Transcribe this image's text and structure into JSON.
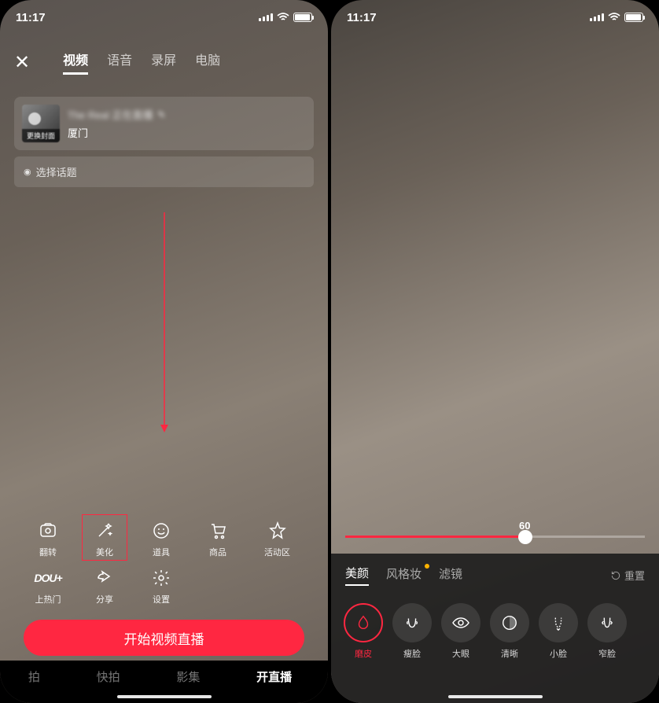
{
  "status": {
    "time": "11:17"
  },
  "left": {
    "tabs": [
      "视频",
      "语音",
      "录屏",
      "电脑"
    ],
    "active_tab": 0,
    "cover_label": "更换封面",
    "title_blur": "The Real 正在直播",
    "location": "厦门",
    "topic_label": "选择话题",
    "tools_row1": [
      {
        "label": "翻转",
        "icon": "flip"
      },
      {
        "label": "美化",
        "icon": "wand",
        "highlight": true
      },
      {
        "label": "道具",
        "icon": "smile"
      },
      {
        "label": "商品",
        "icon": "cart"
      },
      {
        "label": "活动区",
        "icon": "star"
      }
    ],
    "tools_row2": [
      {
        "label": "上热门",
        "icon": "dou",
        "text": "DOU+"
      },
      {
        "label": "分享",
        "icon": "share"
      },
      {
        "label": "设置",
        "icon": "settings"
      }
    ],
    "start_button": "开始视频直播",
    "bottom_tabs": [
      "拍",
      "快拍",
      "影集",
      "开直播"
    ],
    "bottom_active": 3
  },
  "right": {
    "slider_value": "60",
    "slider_percent": 60,
    "beauty_tabs": [
      {
        "label": "美颜",
        "active": true
      },
      {
        "label": "风格妆",
        "badge": true
      },
      {
        "label": "滤镜"
      }
    ],
    "reset_label": "重置",
    "beauty_opts": [
      {
        "label": "磨皮",
        "icon": "drop",
        "active": true
      },
      {
        "label": "瘦脸",
        "icon": "face"
      },
      {
        "label": "大眼",
        "icon": "eye"
      },
      {
        "label": "清晰",
        "icon": "contrast"
      },
      {
        "label": "小脸",
        "icon": "smallface"
      },
      {
        "label": "窄脸",
        "icon": "narrowface"
      }
    ]
  }
}
